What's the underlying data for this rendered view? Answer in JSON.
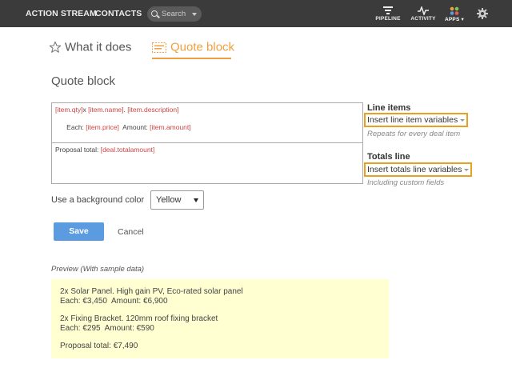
{
  "nav": {
    "action_stream": "ACTION STREAM",
    "contacts": "CONTACTS",
    "search_placeholder": "Search",
    "pipeline": "PIPELINE",
    "activity": "ACTIVITY",
    "apps": "APPS"
  },
  "tabs": [
    {
      "label": "What it does",
      "icon": "star-outline-icon",
      "active": false
    },
    {
      "label": "Quote block",
      "icon": "quote-block-icon",
      "active": true
    }
  ],
  "section_title": "Quote block",
  "editor": {
    "line1_parts": [
      {
        "text": "[item.qty]",
        "var": true
      },
      {
        "text": "x ",
        "var": false
      },
      {
        "text": "[item.name]",
        "var": true
      },
      {
        "text": ". ",
        "var": false
      },
      {
        "text": "[item.description]",
        "var": true
      }
    ],
    "line2_parts": [
      {
        "text": "Each: ",
        "var": false
      },
      {
        "text": "[item.price]",
        "var": true
      },
      {
        "text": "  Amount: ",
        "var": false
      },
      {
        "text": "[item.amount]",
        "var": true
      }
    ],
    "total_parts": [
      {
        "text": "Proposal total: ",
        "var": false
      },
      {
        "text": "[deal.totalamount]",
        "var": true
      }
    ]
  },
  "line_items": {
    "heading": "Line items",
    "button": "Insert line item variables",
    "hint": "Repeats for every deal item"
  },
  "totals_line": {
    "heading": "Totals line",
    "button": "Insert totals line variables",
    "hint": "Including custom fields"
  },
  "background": {
    "label": "Use a background color",
    "selected": "Yellow"
  },
  "actions": {
    "save": "Save",
    "cancel": "Cancel"
  },
  "preview": {
    "label": "Preview (With sample data)",
    "item1_line1": "2x Solar Panel. High gain PV, Eco-rated solar panel",
    "item1_line2": "Each: €3,450  Amount: €6,900",
    "item2_line1": "2x Fixing Bracket. 120mm roof fixing bracket",
    "item2_line2": "Each: €295  Amount: €590",
    "total": "Proposal total: €7,490"
  },
  "colors": {
    "topbar": "#3b3b3b",
    "accent": "#f0a040",
    "variable": "#d04545",
    "save": "#5b9be0",
    "preview_bg": "#ffffd2",
    "highlight_border": "#e8a020"
  }
}
